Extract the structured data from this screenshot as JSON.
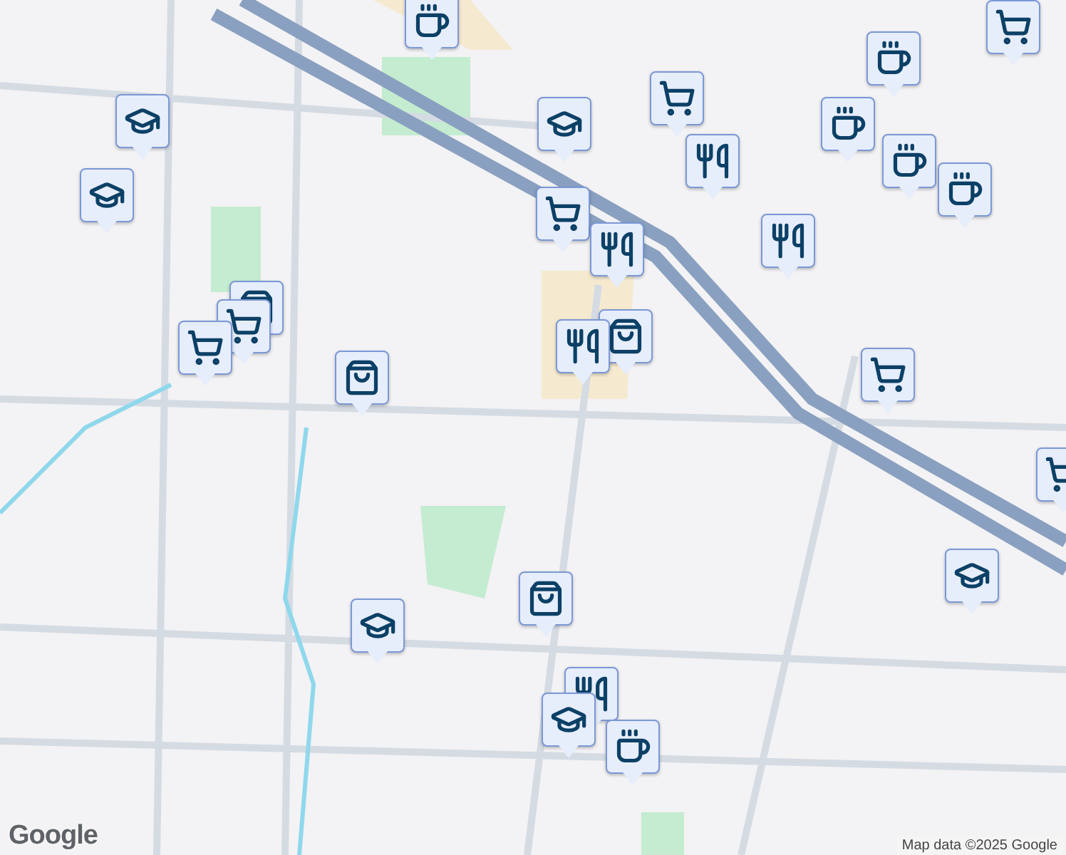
{
  "markers": [
    {
      "kind": "coffee"
    },
    {
      "kind": "school"
    },
    {
      "kind": "school"
    },
    {
      "kind": "bag"
    },
    {
      "kind": "cart"
    },
    {
      "kind": "cart"
    },
    {
      "kind": "bag"
    },
    {
      "kind": "school"
    },
    {
      "kind": "cart"
    },
    {
      "kind": "restaurant"
    },
    {
      "kind": "cart"
    },
    {
      "kind": "restaurant"
    },
    {
      "kind": "bag"
    },
    {
      "kind": "restaurant"
    },
    {
      "kind": "cart"
    },
    {
      "kind": "coffee"
    },
    {
      "kind": "coffee"
    },
    {
      "kind": "coffee"
    },
    {
      "kind": "coffee"
    },
    {
      "kind": "restaurant"
    },
    {
      "kind": "cart"
    },
    {
      "kind": "cart"
    },
    {
      "kind": "school"
    },
    {
      "kind": "bag"
    },
    {
      "kind": "school"
    },
    {
      "kind": "restaurant"
    },
    {
      "kind": "school"
    },
    {
      "kind": "coffee"
    }
  ],
  "logo": "Google",
  "attribution": "Map data ©2025 Google"
}
